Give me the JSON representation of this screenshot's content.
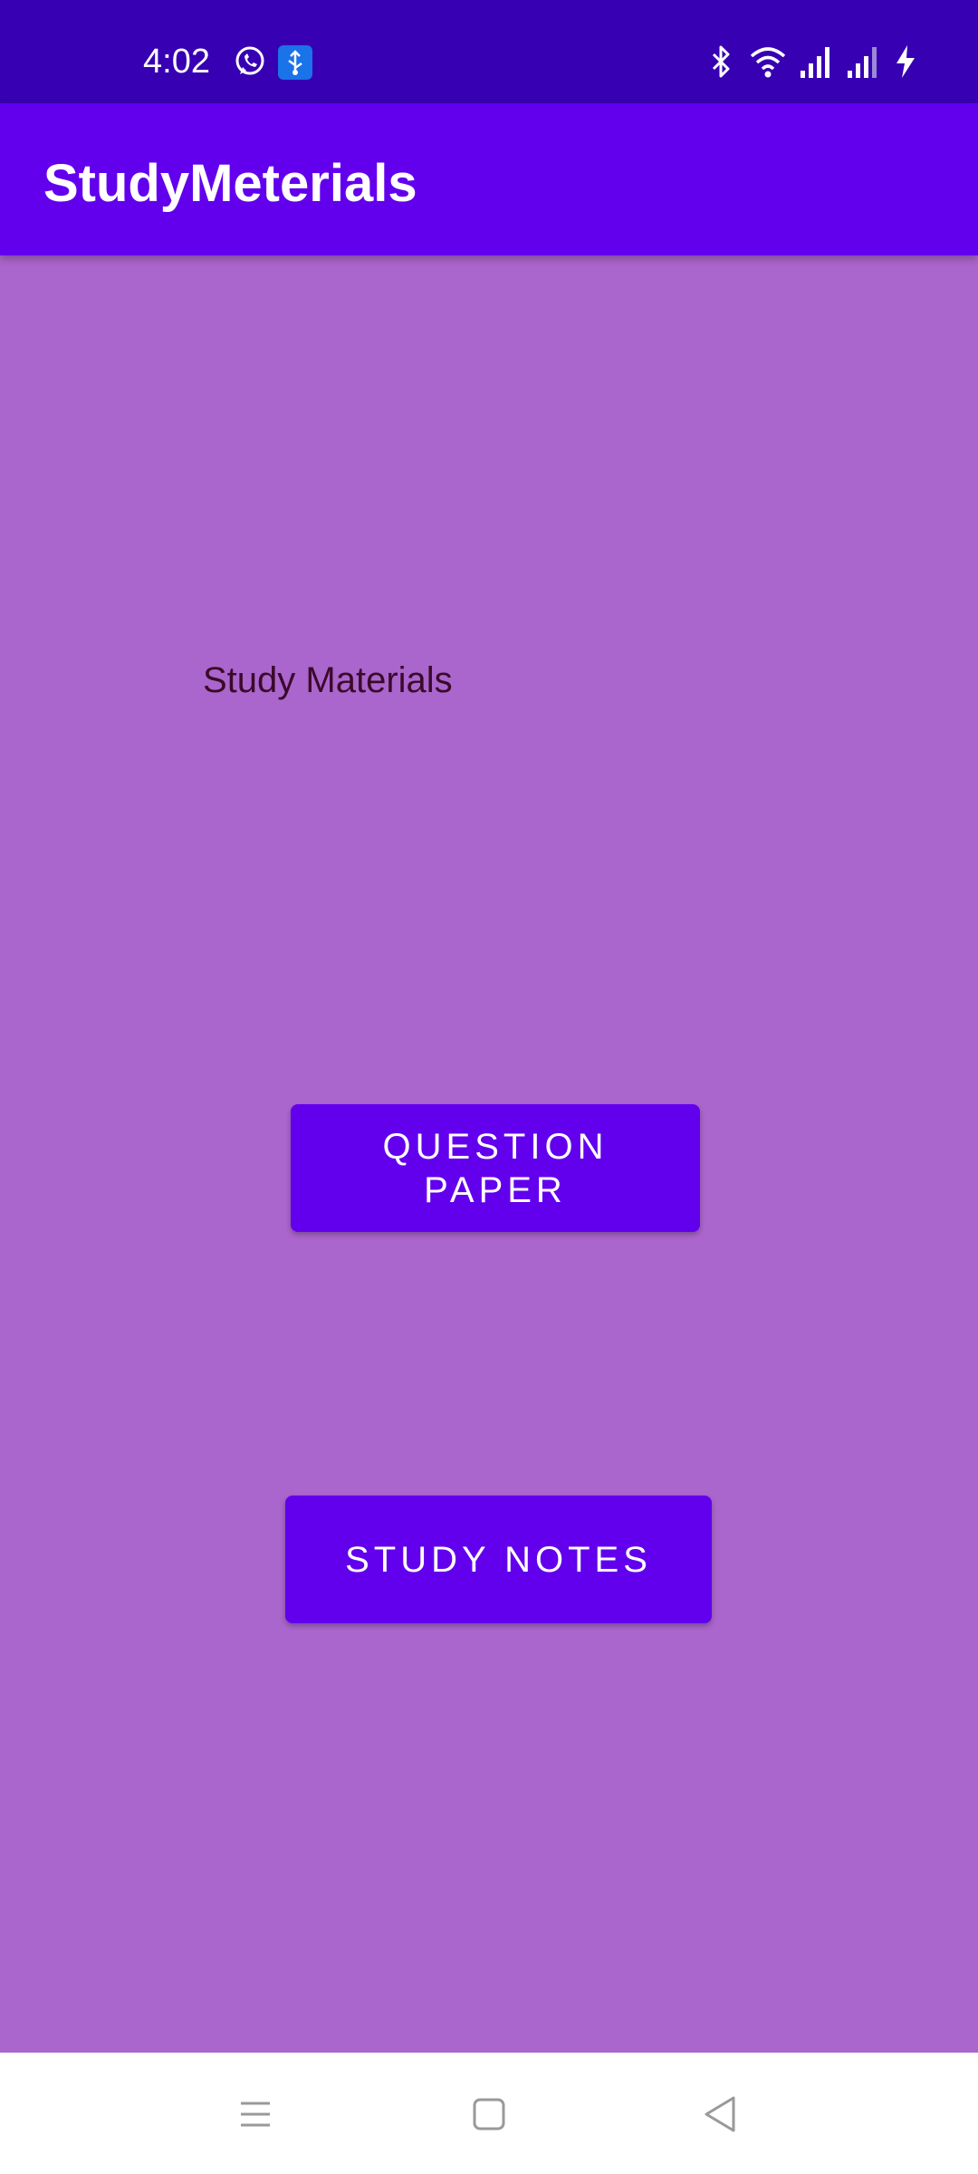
{
  "status_bar": {
    "time": "4:02",
    "left_icons": [
      "whatsapp-icon",
      "usb-icon"
    ],
    "right_icons": [
      "bluetooth-icon",
      "wifi-icon",
      "signal-1-icon",
      "signal-2-icon",
      "charging-icon"
    ]
  },
  "app_bar": {
    "title": "StudyMeterials"
  },
  "main": {
    "label": "Study Materials",
    "buttons": [
      {
        "label": "QUESTION PAPER"
      },
      {
        "label": "STUDY NOTES"
      }
    ]
  },
  "nav_bar": {
    "icons": [
      "menu-icon",
      "home-icon",
      "back-icon"
    ]
  },
  "colors": {
    "status_bar": "#3700b3",
    "app_bar": "#6200ee",
    "background": "#aa66cc",
    "button": "#6200ee"
  }
}
